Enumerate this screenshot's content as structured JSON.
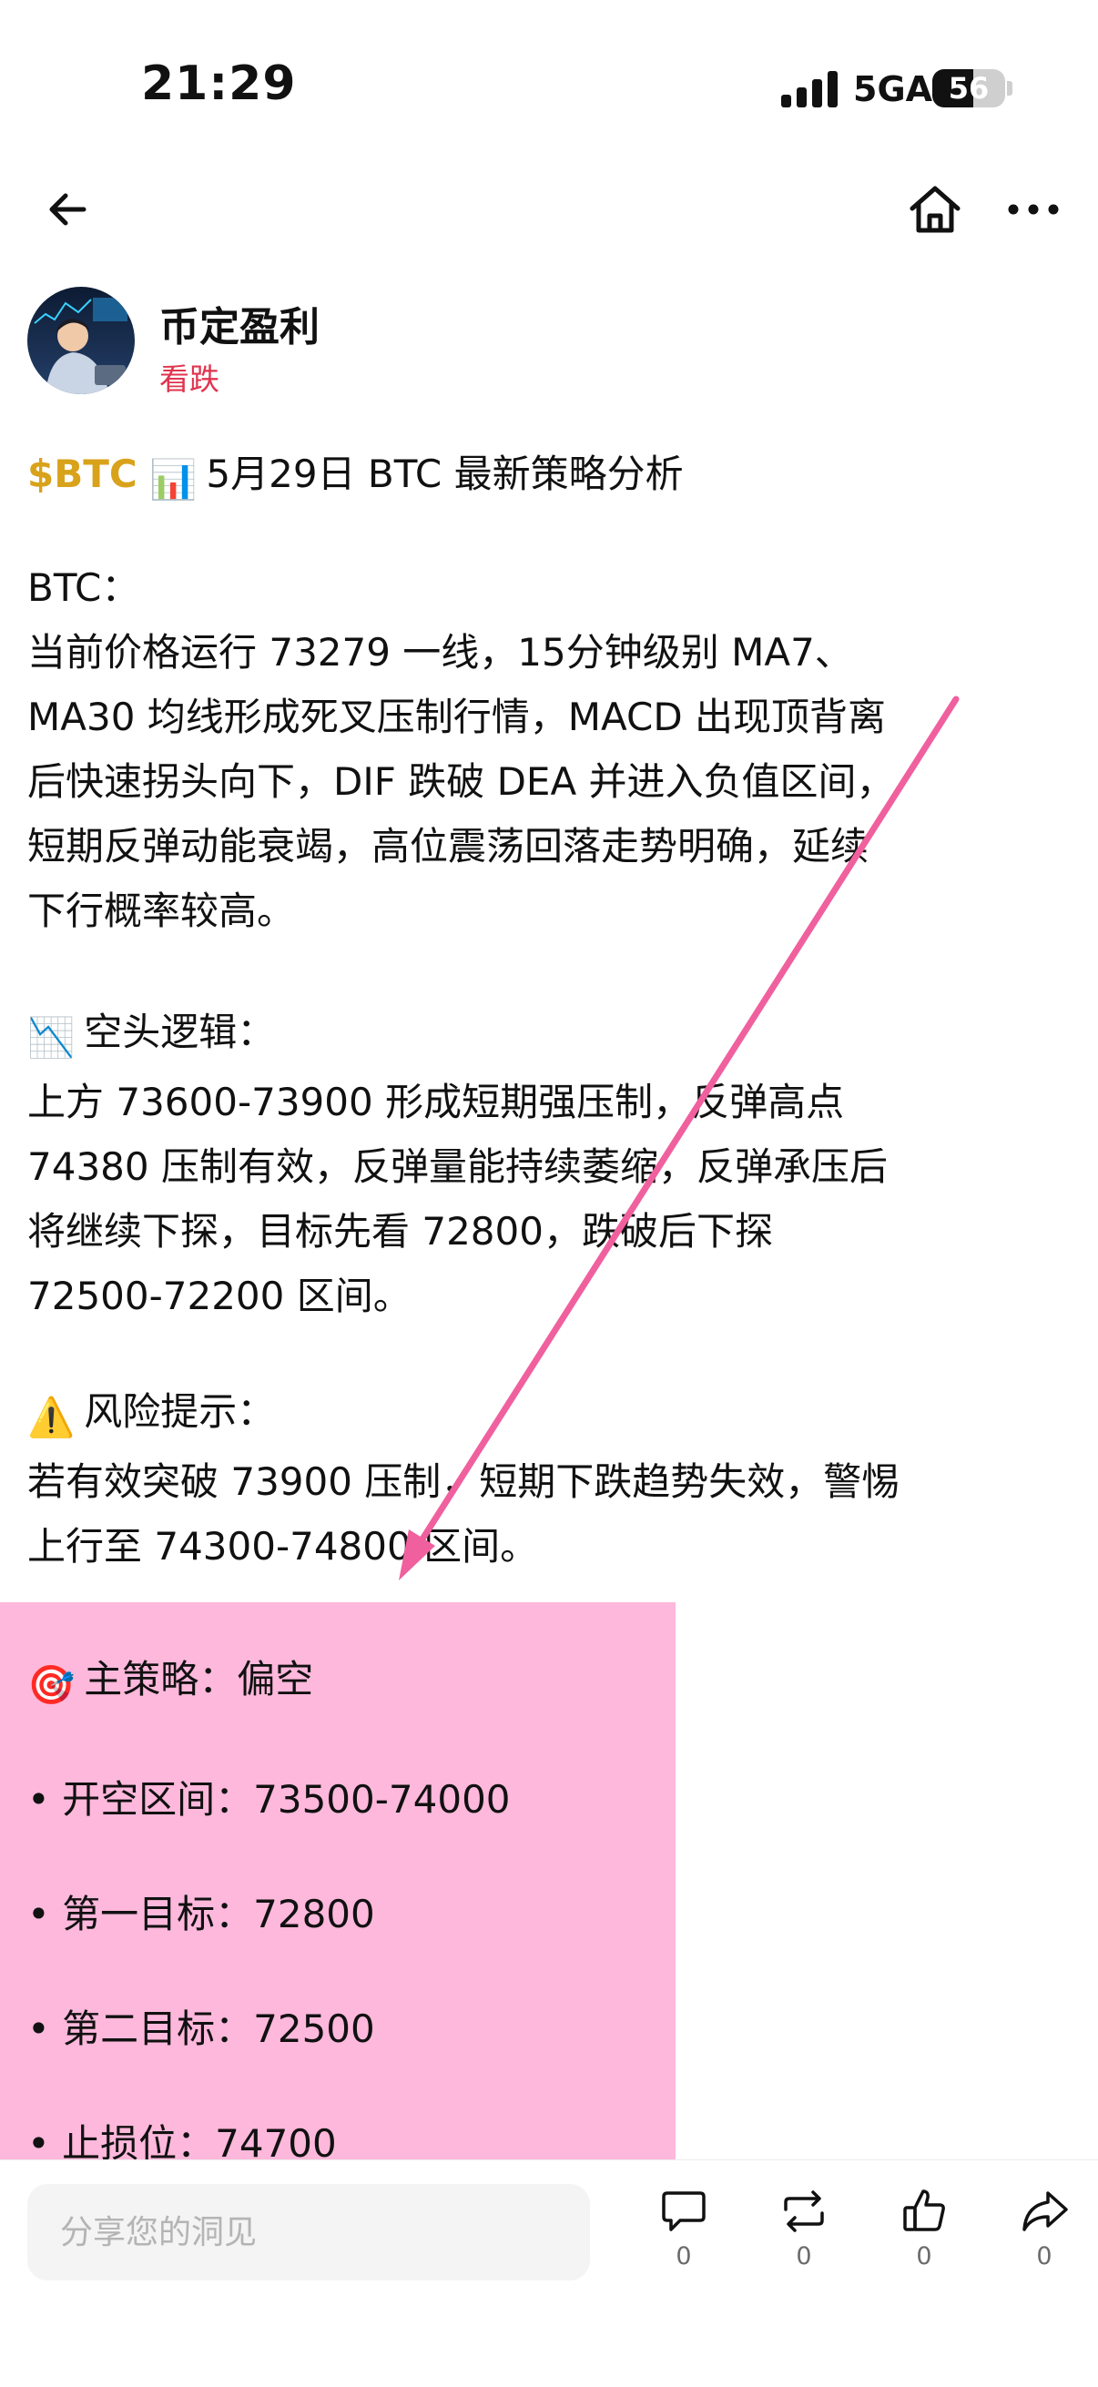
{
  "status_bar": {
    "time": "21:29",
    "network": "5GA",
    "battery": "56",
    "battery_fraction": 0.56
  },
  "nav": {
    "back_icon": "arrow-left-icon",
    "home_icon": "home-icon",
    "more_icon": "more-horizontal-icon"
  },
  "author": {
    "name": "币定盈利",
    "tag": "看跌",
    "tag_color": "#e0344f"
  },
  "post": {
    "ticker": "$BTC",
    "ticker_color": "#d9a21b",
    "title_emoji": "📊",
    "title": "5月29日 BTC 最新策略分析",
    "section1_heading": "BTC：",
    "section1_lines": [
      "当前价格运行 73279 一线，15分钟级别 MA7、",
      "MA30 均线形成死叉压制行情，MACD 出现顶背离",
      "后快速拐头向下，DIF 跌破 DEA 并进入负值区间，",
      "短期反弹动能衰竭，高位震荡回落走势明确，延续",
      "下行概率较高。"
    ],
    "section2_emoji": "📉",
    "section2_heading": "空头逻辑：",
    "section2_lines": [
      "上方 73600-73900 形成短期强压制，反弹高点",
      "74380 压制有效，反弹量能持续萎缩，反弹承压后",
      "将继续下探，目标先看 72800，跌破后下探",
      "72500-72200 区间。"
    ],
    "section3_emoji": "⚠️",
    "section3_heading": "风险提示：",
    "section3_lines": [
      "若有效突破 73900 压制，短期下跌趋势失效，警惕",
      "上行至 74300-74800 区间。"
    ],
    "strategy_emoji": "🎯",
    "strategy_heading": "主策略：偏空",
    "strategy_items": [
      "开空区间：73500-74000",
      "第一目标：72800",
      "第二目标：72500",
      "止损位：74700"
    ],
    "bullet": "•",
    "highlight_color": "#feb8dc",
    "arrow_color": "#f0609e"
  },
  "bottom_bar": {
    "share_placeholder": "分享您的洞见",
    "comment_count": "0",
    "repost_count": "0",
    "like_count": "0",
    "share_count": "0",
    "comment_icon": "comment-icon",
    "repost_icon": "repost-icon",
    "like_icon": "thumbs-up-icon",
    "share_icon": "share-icon"
  }
}
